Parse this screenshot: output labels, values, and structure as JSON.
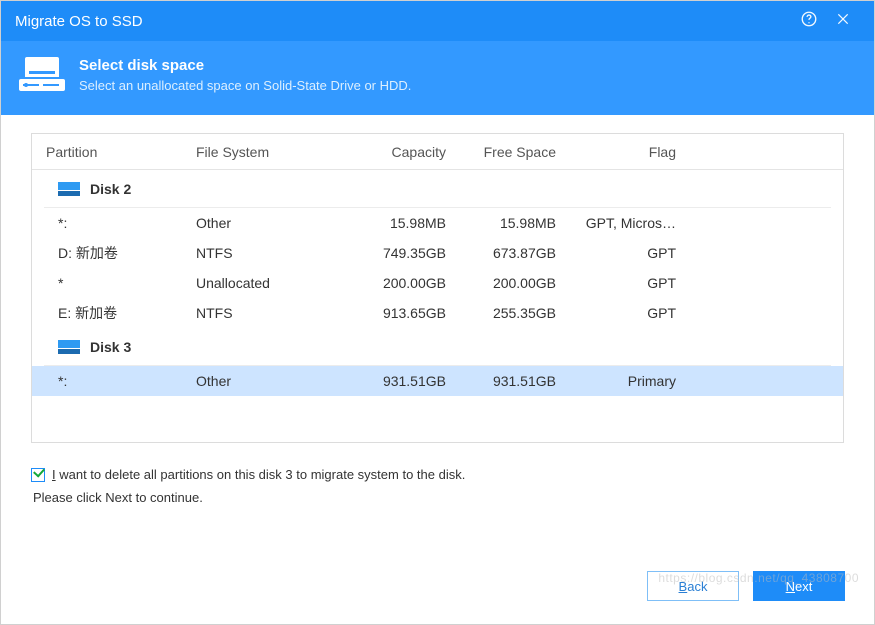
{
  "window": {
    "title": "Migrate OS to SSD"
  },
  "banner": {
    "title": "Select disk space",
    "subtitle": "Select an unallocated space on Solid-State Drive or HDD."
  },
  "columns": {
    "partition": "Partition",
    "filesystem": "File System",
    "capacity": "Capacity",
    "freespace": "Free Space",
    "flag": "Flag"
  },
  "disks": [
    {
      "name": "Disk 2",
      "partitions": [
        {
          "part": "*:",
          "fs": "Other",
          "cap": "15.98MB",
          "free": "15.98MB",
          "flag": "GPT, Micros…",
          "selected": false
        },
        {
          "part": "D:  新加卷",
          "fs": "NTFS",
          "cap": "749.35GB",
          "free": "673.87GB",
          "flag": "GPT",
          "selected": false
        },
        {
          "part": "*",
          "fs": "Unallocated",
          "cap": "200.00GB",
          "free": "200.00GB",
          "flag": "GPT",
          "selected": false
        },
        {
          "part": "E:  新加卷",
          "fs": "NTFS",
          "cap": "913.65GB",
          "free": "255.35GB",
          "flag": "GPT",
          "selected": false
        }
      ]
    },
    {
      "name": "Disk 3",
      "partitions": [
        {
          "part": "*:",
          "fs": "Other",
          "cap": "931.51GB",
          "free": "931.51GB",
          "flag": "Primary",
          "selected": true
        }
      ]
    }
  ],
  "checkbox": {
    "checked": true,
    "label_pre": "I",
    "label_rest": " want to delete all partitions on this disk 3 to migrate system to the disk."
  },
  "instruction": "Please click Next to continue.",
  "buttons": {
    "back_u": "B",
    "back_rest": "ack",
    "next_u": "N",
    "next_rest": "ext"
  },
  "watermark": "https://blog.csdn.net/qq_43808700"
}
